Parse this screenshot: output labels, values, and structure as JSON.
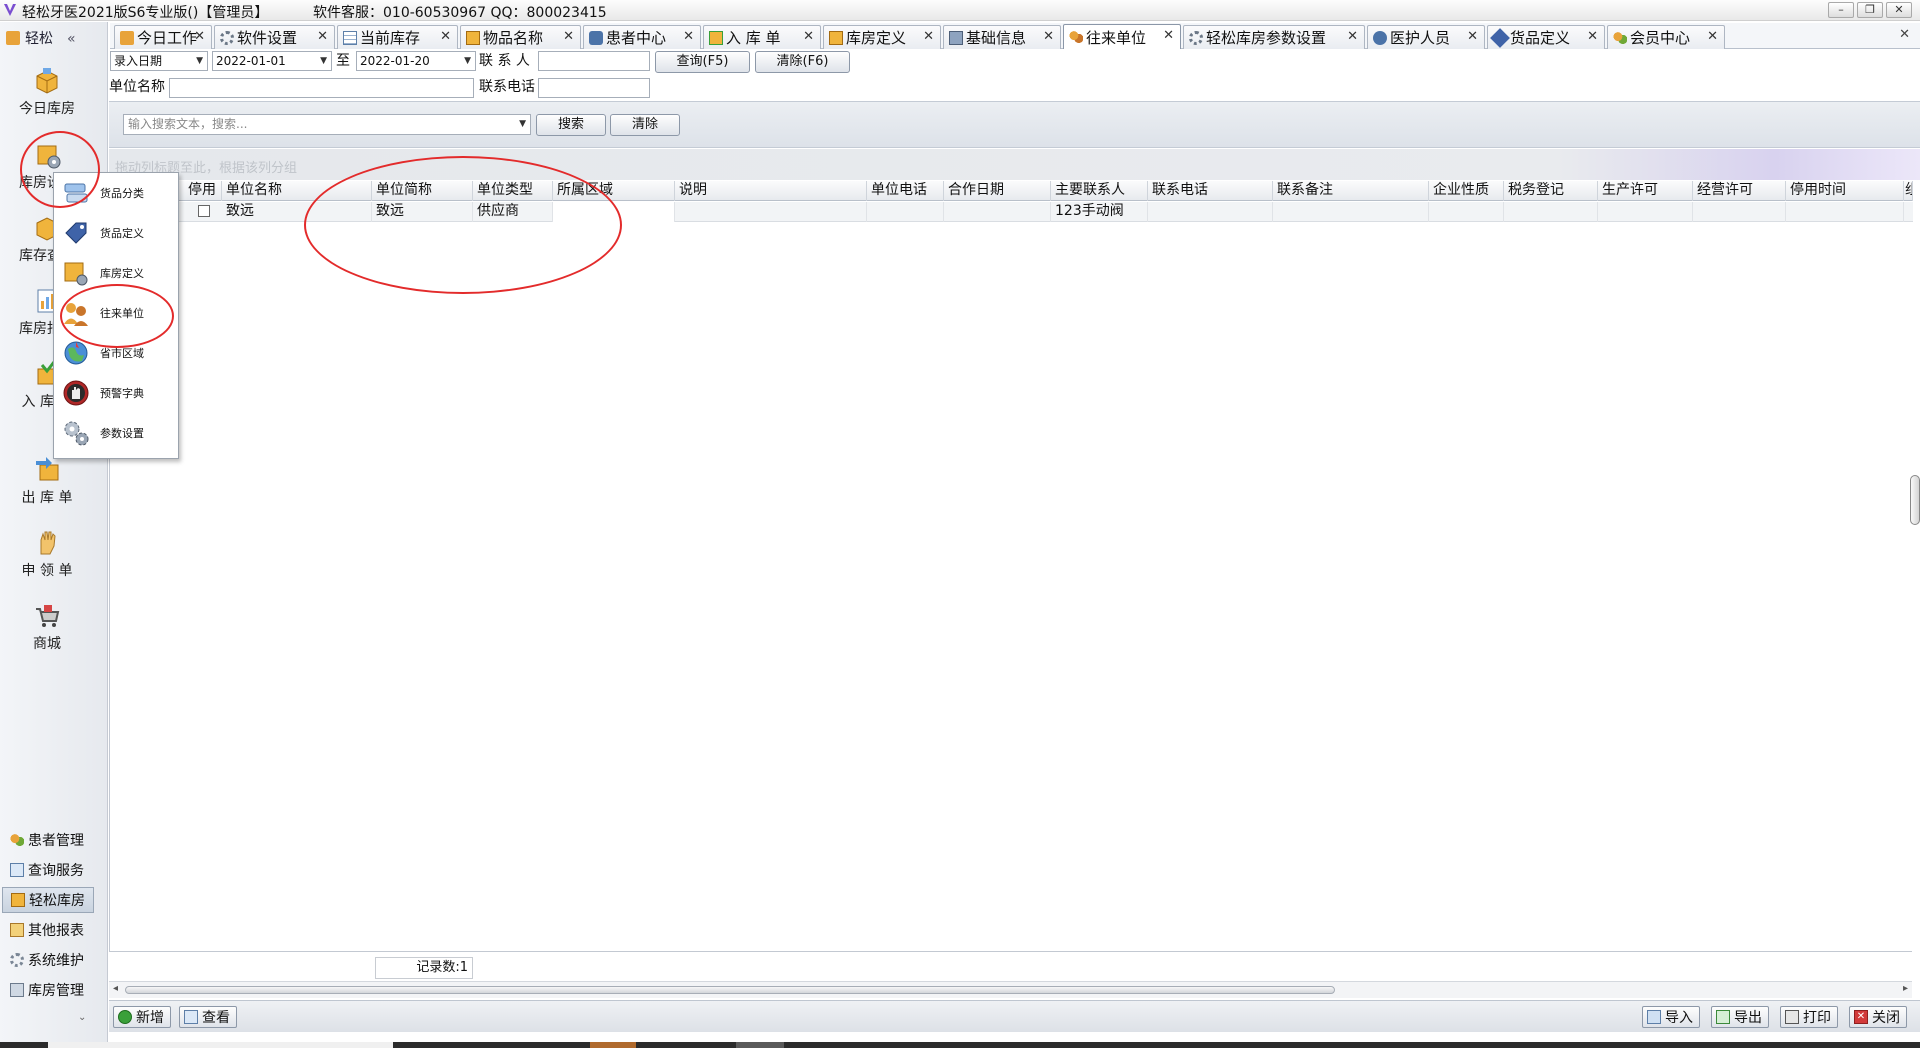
{
  "titlebar": {
    "title": "轻松牙医2021版S6专业版()【管理员】",
    "hotline": "软件客服：010-60530967 QQ：800023415",
    "min": "–",
    "restore": "❐",
    "close": "✕"
  },
  "sidebar": {
    "header": "轻松",
    "collapse": "«",
    "items": [
      {
        "label": "今日库房",
        "icon": "box-icon"
      },
      {
        "label": "库房设置",
        "icon": "box-gear-icon"
      },
      {
        "label": "库存查询",
        "icon": "box-search-icon"
      },
      {
        "label": "库房报表",
        "icon": "report-icon"
      },
      {
        "label": "入 库 单",
        "icon": "inbound-icon"
      },
      {
        "label": "出 库 单",
        "icon": "outbound-icon"
      },
      {
        "label": "申 领 单",
        "icon": "hand-icon"
      },
      {
        "label": "商城",
        "icon": "cart-icon"
      }
    ],
    "bottom": [
      {
        "label": "患者管理"
      },
      {
        "label": "查询服务"
      },
      {
        "label": "轻松库房"
      },
      {
        "label": "其他报表"
      },
      {
        "label": "系统维护"
      },
      {
        "label": "库房管理"
      }
    ],
    "scroll_down": "⌄"
  },
  "tabs": [
    {
      "label": "今日工作"
    },
    {
      "label": "软件设置"
    },
    {
      "label": "当前库存"
    },
    {
      "label": "物品名称"
    },
    {
      "label": "患者中心"
    },
    {
      "label": "入 库 单"
    },
    {
      "label": "库房定义"
    },
    {
      "label": "基础信息"
    },
    {
      "label": "往来单位"
    },
    {
      "label": "轻松库房参数设置"
    },
    {
      "label": "医护人员"
    },
    {
      "label": "货品定义"
    },
    {
      "label": "会员中心"
    }
  ],
  "tab_close": "✕",
  "filters": {
    "date_type": "录入日期",
    "date_from": "2022-01-01",
    "to_label": "至",
    "date_to": "2022-01-20",
    "contact_label": "联 系 人",
    "contact_value": "",
    "query_button": "查询(F5)",
    "clear_button": "清除(F6)",
    "unit_name_label": "单位名称",
    "unit_name_value": "",
    "phone_label": "联系电话",
    "phone_value": ""
  },
  "search": {
    "placeholder": "输入搜索文本，搜索...",
    "search_button": "搜索",
    "clear_button": "清除"
  },
  "group_hint": "拖动列标题至此，根据该列分组",
  "grid": {
    "columns": [
      "停用",
      "单位名称",
      "单位简称",
      "单位类型",
      "所属区域",
      "说明",
      "单位电话",
      "合作日期",
      "主要联系人",
      "联系电话",
      "联系备注",
      "企业性质",
      "税务登记",
      "生产许可",
      "经营许可",
      "停用时间",
      "组"
    ],
    "rows": [
      {
        "disabled": false,
        "name": "致远",
        "short": "致远",
        "type": "供应商",
        "region": "",
        "desc": "",
        "phone": "",
        "date": "",
        "contact": "123手动阀",
        "contact_phone": "",
        "note": "",
        "nature": "",
        "tax": "",
        "prod": "",
        "biz": "",
        "stop": "",
        "g": ""
      }
    ]
  },
  "record_count": "记录数:1",
  "toolbar": {
    "add": "新增",
    "view": "查看",
    "import": "导入",
    "export": "导出",
    "print": "打印",
    "close": "关闭"
  },
  "popup_menu": [
    {
      "label": "货品分类",
      "icon": "category-icon"
    },
    {
      "label": "货品定义",
      "icon": "tag-icon"
    },
    {
      "label": "库房定义",
      "icon": "warehouse-icon"
    },
    {
      "label": "往来单位",
      "icon": "partners-icon"
    },
    {
      "label": "省市区域",
      "icon": "globe-icon"
    },
    {
      "label": "预警字典",
      "icon": "stop-hand-icon"
    },
    {
      "label": "参数设置",
      "icon": "gears-icon"
    }
  ],
  "colors": {
    "accent": "#3a6ea5",
    "annotation": "#e32b2b",
    "orange": "#e8a33a"
  }
}
